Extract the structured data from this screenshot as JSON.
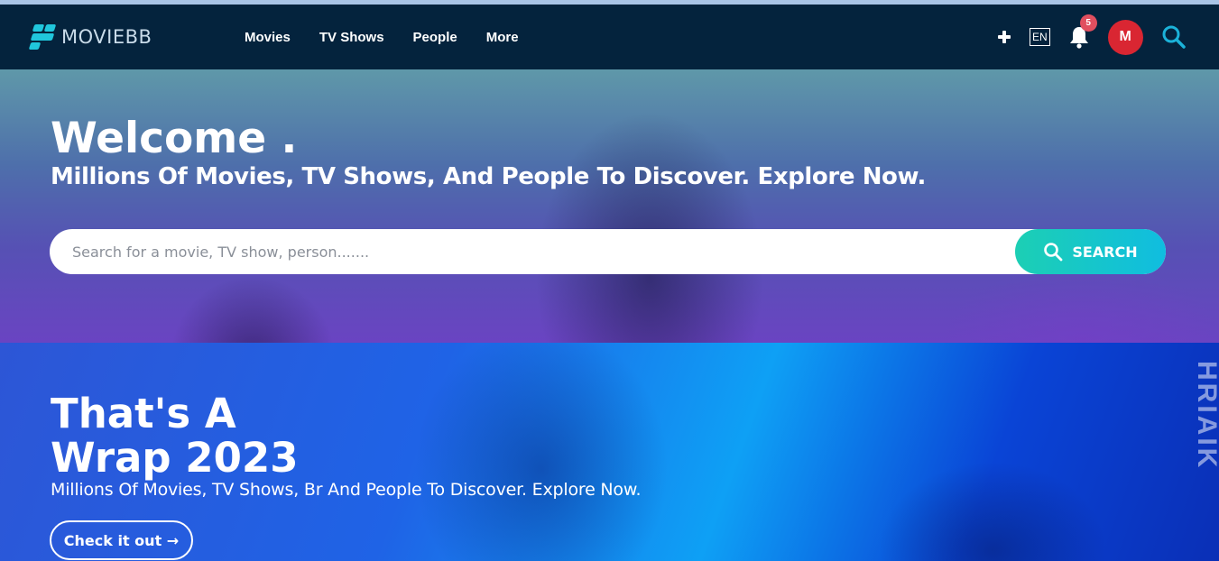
{
  "brand": {
    "name": "MOVIEBB",
    "accent": "#20c6dc"
  },
  "nav": {
    "links": [
      "Movies",
      "TV Shows",
      "People",
      "More"
    ],
    "lang": "EN",
    "notification_count": "5",
    "avatar_initial": "M",
    "icons": [
      "plus-icon",
      "bell-icon",
      "search-icon"
    ]
  },
  "hero": {
    "title": "Welcome .",
    "subtitle": "Millions Of Movies, TV Shows, And People To Discover. Explore Now.",
    "search_placeholder": "Search for a movie, TV show, person.......",
    "search_button": "SEARCH"
  },
  "wrap": {
    "title_line1": "That's A",
    "title_line2": "Wrap 2023",
    "subtitle": "Millions Of Movies, TV Shows, Br And People To Discover. Explore Now.",
    "button": "Check it out →",
    "side_text": "HRIAIK"
  },
  "colors": {
    "navbar": "#04233d",
    "badge": "#e14f5f",
    "avatar": "#d92632",
    "search_button_from": "#1ccfb4",
    "search_button_to": "#10bde0"
  }
}
